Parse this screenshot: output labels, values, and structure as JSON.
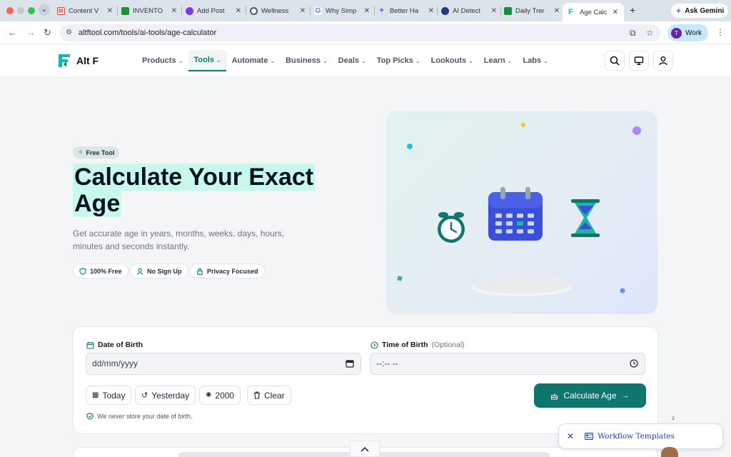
{
  "browser": {
    "tabs": [
      {
        "title": "Content V",
        "icon": "gmail-icon",
        "color": "#ea4335"
      },
      {
        "title": "INVENTO",
        "icon": "sheets-icon",
        "color": "#1e8e3e"
      },
      {
        "title": "Add Post",
        "icon": "plugin-icon",
        "color": "#7c3aed"
      },
      {
        "title": "Wellness",
        "icon": "openai-icon",
        "color": "#555555"
      },
      {
        "title": "Why Simp",
        "icon": "google-icon",
        "color": "#4285f4"
      },
      {
        "title": "Better Ha",
        "icon": "gemini-icon",
        "color": "#6c63ff"
      },
      {
        "title": "AI Detect",
        "icon": "detector-icon",
        "color": "#1e3a8a"
      },
      {
        "title": "Daily Trer",
        "icon": "sheets-icon",
        "color": "#1e8e3e"
      }
    ],
    "active_tab": {
      "title": "Age Calc",
      "icon": "altf-icon"
    },
    "new_tab_label": "+",
    "gemini_label": "Ask Gemini",
    "url": "altftool.com/tools/ai-tools/age-calculator",
    "profile_label": "Work",
    "profile_initial": "T"
  },
  "site": {
    "brand": "Alt F",
    "brand_color": "#14b8a6",
    "nav": [
      {
        "label": "Products",
        "active": false
      },
      {
        "label": "Tools",
        "active": true
      },
      {
        "label": "Automate",
        "active": false
      },
      {
        "label": "Business",
        "active": false
      },
      {
        "label": "Deals",
        "active": false
      },
      {
        "label": "Top Picks",
        "active": false
      },
      {
        "label": "Lookouts",
        "active": false
      },
      {
        "label": "Learn",
        "active": false
      },
      {
        "label": "Labs",
        "active": false
      }
    ]
  },
  "hero": {
    "badge": "Free Tool",
    "title_line1": "Calculate Your Exact",
    "title_line2": "Age",
    "subtitle": "Get accurate age in years, months, weeks, days, hours, minutes and seconds instantly.",
    "chips": [
      {
        "label": "100% Free",
        "icon": "shield-icon"
      },
      {
        "label": "No Sign Up",
        "icon": "user-icon"
      },
      {
        "label": "Privacy Focused",
        "icon": "lock-icon"
      }
    ],
    "highlight_color": "#c8f7ec",
    "accent_color": "#0f766e"
  },
  "calculator": {
    "dob_label": "Date of Birth",
    "dob_placeholder": "dd/mm/yyyy",
    "tob_label": "Time of Birth",
    "tob_optional": "(Optional)",
    "tob_placeholder": "--:-- --",
    "quick_buttons": [
      {
        "label": "Today",
        "icon": "calendar-icon"
      },
      {
        "label": "Yesterday",
        "icon": "undo-icon"
      },
      {
        "label": "2000",
        "icon": "sparkle-icon"
      },
      {
        "label": "Clear",
        "icon": "trash-icon"
      }
    ],
    "calculate_label": "Calculate Age",
    "privacy_note": "We never store your date of birth."
  },
  "workflow_widget": {
    "label": "Workflow Templates"
  },
  "sleep_indicator": "z"
}
